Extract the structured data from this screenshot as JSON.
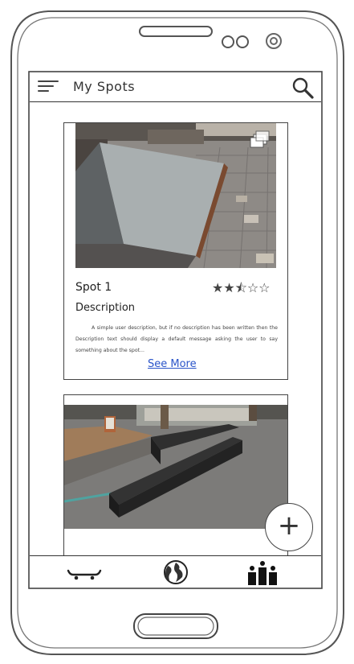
{
  "app": {
    "title": "My Spots"
  },
  "icons": {
    "menu": "hamburger-menu-icon",
    "search": "search-icon",
    "photo_gallery": "gallery-icon",
    "add": "plus-icon",
    "nav_skate": "skateboard-icon",
    "nav_explore": "globe-icon",
    "nav_ranking": "leaderboard-icon"
  },
  "spots": [
    {
      "title": "Spot 1",
      "rating": 2.5,
      "rating_max": 5,
      "stars_display": "★★⯪☆☆",
      "description_label": "Description",
      "description_text": "A simple user description, but if no description has been written then the Description text should display a default message asking the user to say something about the spot...",
      "see_more_label": "See More"
    },
    {
      "title": "",
      "rating": null
    }
  ],
  "fab": {
    "label": "+"
  },
  "colors": {
    "link": "#2a54c9",
    "outline": "#444444"
  }
}
